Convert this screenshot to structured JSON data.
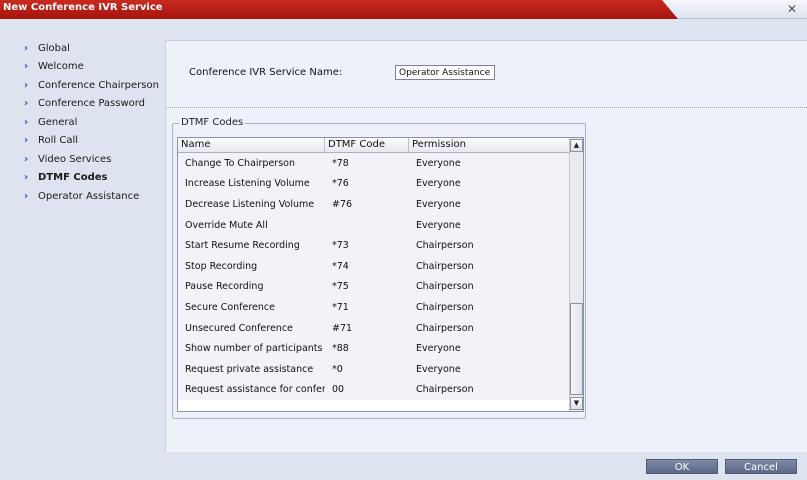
{
  "window": {
    "title": "New Conference IVR Service",
    "close_icon": "close-icon"
  },
  "sidebar": {
    "items": [
      {
        "label": "Global",
        "active": false
      },
      {
        "label": "Welcome",
        "active": false
      },
      {
        "label": "Conference Chairperson",
        "active": false
      },
      {
        "label": "Conference Password",
        "active": false
      },
      {
        "label": "General",
        "active": false
      },
      {
        "label": "Roll Call",
        "active": false
      },
      {
        "label": "Video Services",
        "active": false
      },
      {
        "label": "DTMF Codes",
        "active": true
      },
      {
        "label": "Operator Assistance",
        "active": false
      }
    ]
  },
  "form": {
    "name_label": "Conference IVR Service Name:",
    "name_value": "Operator Assistance"
  },
  "dtmf": {
    "group_title": "DTMF Codes",
    "columns": [
      "Name",
      "DTMF Code",
      "Permission"
    ],
    "rows": [
      [
        "Change To Chairperson",
        "*78",
        "Everyone"
      ],
      [
        "Increase Listening Volume",
        "*76",
        "Everyone"
      ],
      [
        "Decrease Listening Volume",
        "#76",
        "Everyone"
      ],
      [
        "Override Mute All",
        "",
        "Everyone"
      ],
      [
        "Start Resume Recording",
        "*73",
        "Chairperson"
      ],
      [
        "Stop Recording",
        "*74",
        "Chairperson"
      ],
      [
        "Pause Recording",
        "*75",
        "Chairperson"
      ],
      [
        "Secure Conference",
        "*71",
        "Chairperson"
      ],
      [
        "Unsecured Conference",
        "#71",
        "Chairperson"
      ],
      [
        "Show number of participants",
        "*88",
        "Everyone"
      ],
      [
        "Request private assistance",
        "*0",
        "Everyone"
      ],
      [
        "Request assistance for confer",
        "00",
        "Chairperson"
      ]
    ]
  },
  "buttons": {
    "ok": "OK",
    "cancel": "Cancel"
  },
  "colors": {
    "title_bar": "#b81c14",
    "accent_chevron": "#1b5dbf",
    "button": "#6b7694"
  }
}
